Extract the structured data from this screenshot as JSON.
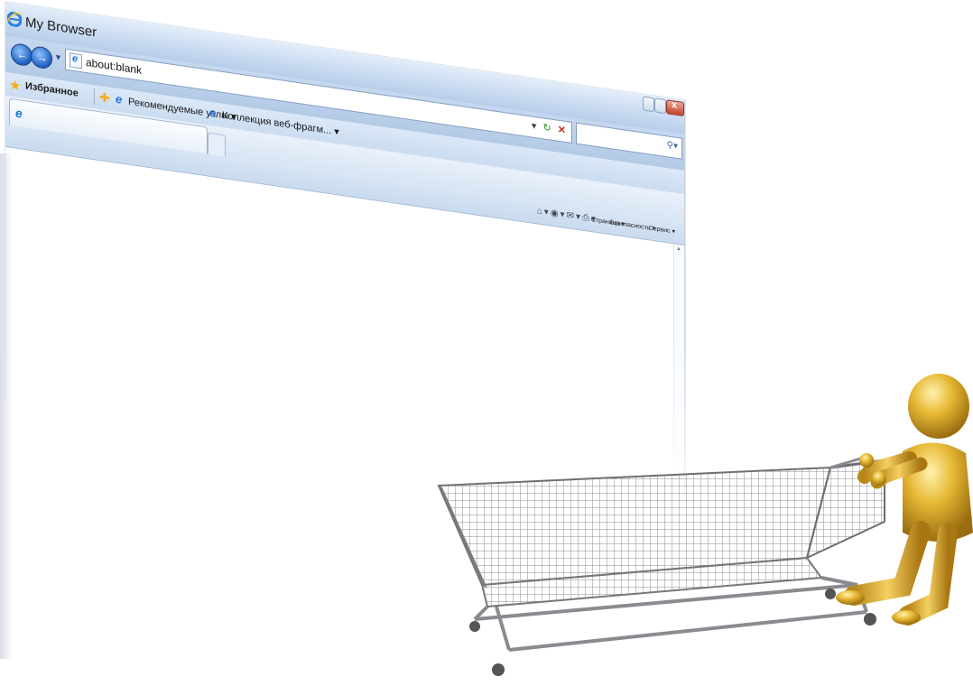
{
  "window": {
    "title": "My Browser"
  },
  "address_bar": {
    "url": "about:blank"
  },
  "favorites_bar": {
    "favorites_label": "Избранное",
    "suggested_sites": "Рекомендуемые узлы ▾",
    "web_slices": "Коллекция веб-фрагм... ▾"
  },
  "command_bar": {
    "page": "Страница ▾",
    "safety": "Безопасность ▾",
    "tools": "Сервис ▾"
  },
  "icons": [
    "ie-logo-icon",
    "back-arrow-icon",
    "forward-arrow-icon",
    "refresh-icon",
    "stop-icon",
    "search-icon",
    "favorites-star-icon",
    "home-icon",
    "feeds-icon",
    "mail-icon",
    "print-icon",
    "help-icon"
  ],
  "colors": {
    "chrome": "#c8daf1",
    "accent": "#1f74d8",
    "figure": "#e0b12e"
  }
}
